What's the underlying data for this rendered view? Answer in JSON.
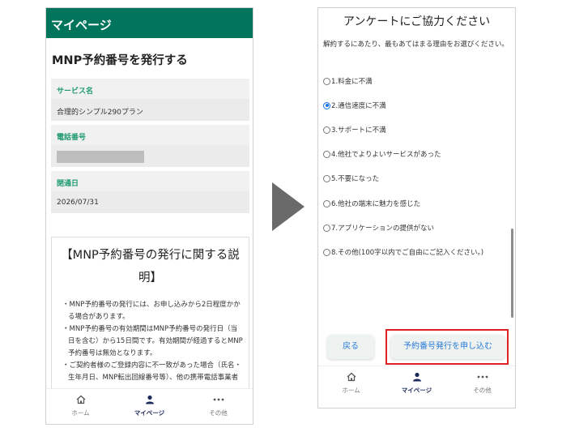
{
  "left": {
    "header": "マイページ",
    "title": "MNP予約番号を発行する",
    "fields": [
      {
        "label": "サービス名",
        "value": "合理的シンプル290プラン"
      },
      {
        "label": "電話番号",
        "value": ""
      },
      {
        "label": "閉通日",
        "value": "2026/07/31"
      }
    ],
    "desc_title": "【MNP予約番号の発行に関する説明】",
    "desc_items": [
      "・MNP予約番号の発行には、お申し込みから2日程度かかる場合があります。",
      "・MNP予約番号の有効期間はMNP予約番号の発行日（当日を含む）から15日間です。有効期間が経過するとMNP予約番号は無効となります。",
      "・ご契約者様のご登録内容に不一致があった場合（氏名・生年月日、MNP転出回線番号等）、他の携帯電話事業者"
    ]
  },
  "tabs": {
    "home": "ホーム",
    "mypage": "マイページ",
    "other": "その他"
  },
  "right": {
    "title": "アンケートにご協力ください",
    "intro": "解約するにあたり、最もあてはまる理由をお選びください。",
    "options": [
      {
        "label": "1.料金に不満",
        "checked": false
      },
      {
        "label": "2.通信速度に不満",
        "checked": true
      },
      {
        "label": "3.サポートに不満",
        "checked": false
      },
      {
        "label": "4.他社でよりよいサービスがあった",
        "checked": false
      },
      {
        "label": "5.不要になった",
        "checked": false
      },
      {
        "label": "6.他社の端末に魅力を感じた",
        "checked": false
      },
      {
        "label": "7.アプリケーションの提供がない",
        "checked": false
      },
      {
        "label": "8.その他(100字以内でご自由にご記入ください。)",
        "checked": false
      }
    ],
    "back_label": "戻る",
    "submit_label": "予約番号発行を申し込む"
  },
  "colors": {
    "brand_green": "#00755c",
    "label_green": "#1e9a6e",
    "link_blue": "#2b7bd6",
    "highlight_red": "#e02020"
  }
}
